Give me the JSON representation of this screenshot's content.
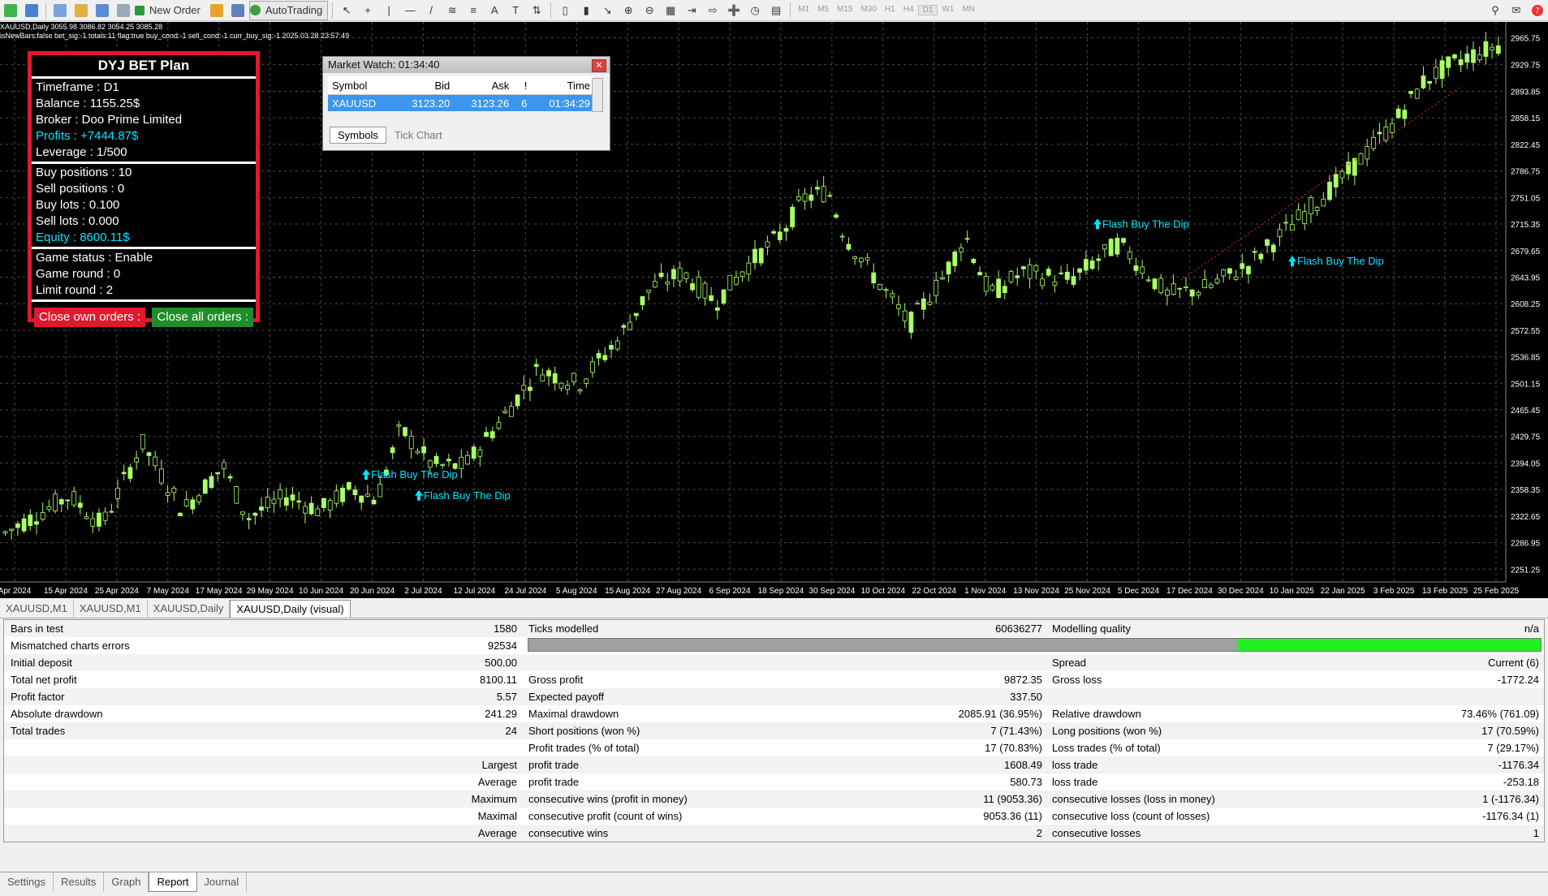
{
  "toolbar": {
    "new_order": "New Order",
    "autotrading": "AutoTrading",
    "timeframes": [
      "M1",
      "M5",
      "M15",
      "M30",
      "H1",
      "H4",
      "D1",
      "W1",
      "MN"
    ],
    "active_timeframe": "D1"
  },
  "chart": {
    "symbol_line": "XAUUSD,Daily  3055.98 3086.82 3054.25 3085.28",
    "info_line": "isNewBars:false bet_sig:-1 totals:11 flag:true buy_cond:-1 sell_cond:-1 curr_buy_sig:-1 2025.03.28 23:57:49",
    "price_labels": [
      "2965.75",
      "2929.75",
      "2893.85",
      "2858.15",
      "2822.45",
      "2786.75",
      "2751.05",
      "2715.35",
      "2679.65",
      "2643.95",
      "2608.25",
      "2572.55",
      "2536.85",
      "2501.15",
      "2465.45",
      "2429.75",
      "2394.05",
      "2358.35",
      "2322.65",
      "2286.95",
      "2251.25"
    ],
    "date_labels": [
      "Apr 2024",
      "15 Apr 2024",
      "25 Apr 2024",
      "7 May 2024",
      "17 May 2024",
      "29 May 2024",
      "10 Jun 2024",
      "20 Jun 2024",
      "2 Jul 2024",
      "12 Jul 2024",
      "24 Jul 2024",
      "5 Aug 2024",
      "15 Aug 2024",
      "27 Aug 2024",
      "6 Sep 2024",
      "18 Sep 2024",
      "30 Sep 2024",
      "10 Oct 2024",
      "22 Oct 2024",
      "1 Nov 2024",
      "13 Nov 2024",
      "25 Nov 2024",
      "5 Dec 2024",
      "17 Dec 2024",
      "30 Dec 2024",
      "10 Jan 2025",
      "22 Jan 2025",
      "3 Feb 2025",
      "13 Feb 2025",
      "25 Feb 2025"
    ],
    "signals": [
      {
        "label": "Flash Buy The Dip"
      },
      {
        "label": "Flash Buy The Dip"
      },
      {
        "label": "Flash Buy The Dip"
      },
      {
        "label": "Flash Buy The Dip"
      }
    ],
    "colors": {
      "background": "#000000",
      "bull": "#aaff66",
      "bear": "#000000",
      "signal": "#00e5ff"
    }
  },
  "panel": {
    "title": "DYJ BET Plan",
    "timeframe": "Timeframe : D1",
    "balance": "Balance : 1155.25$",
    "broker": "Broker : Doo Prime Limited",
    "profits": "Profits : +7444.87$",
    "leverage": "Leverage : 1/500",
    "buy_positions": "Buy positions : 10",
    "sell_positions": "Sell positions : 0",
    "buy_lots": "Buy lots : 0.100",
    "sell_lots": "Sell lots : 0.000",
    "equity": "Equity : 8600.11$",
    "game_status": "Game status :  Enable",
    "game_round": "Game round : 0",
    "limit_round": "Limit round : 2",
    "close_own": "Close own orders :",
    "close_all": "Close all orders :"
  },
  "market_watch": {
    "title": "Market Watch: 01:34:40",
    "columns": [
      "Symbol",
      "Bid",
      "Ask",
      "!",
      "Time"
    ],
    "rows": [
      {
        "symbol": "XAUUSD",
        "bid": "3123.20",
        "ask": "3123.26",
        "spread": "6",
        "time": "01:34:29"
      }
    ],
    "tabs": [
      "Symbols",
      "Tick Chart"
    ]
  },
  "chart_tabs": [
    "XAUUSD,M1",
    "XAUUSD,M1",
    "XAUUSD,Daily",
    "XAUUSD,Daily (visual)"
  ],
  "report": {
    "rows": [
      {
        "l1": "Bars in test",
        "v1": "1580",
        "l2": "Ticks modelled",
        "v2": "60636277",
        "l3": "Modelling quality",
        "v3": "n/a"
      },
      {
        "l1": "Mismatched charts errors",
        "v1": "92534",
        "l2": "",
        "v2": "",
        "l3": "",
        "v3": ""
      },
      {
        "l1": "Initial deposit",
        "v1": "500.00",
        "l2": "",
        "v2": "",
        "l3": "Spread",
        "v3": "Current (6)"
      },
      {
        "l1": "Total net profit",
        "v1": "8100.11",
        "l2": "Gross profit",
        "v2": "9872.35",
        "l3": "Gross loss",
        "v3": "-1772.24"
      },
      {
        "l1": "Profit factor",
        "v1": "5.57",
        "l2": "Expected payoff",
        "v2": "337.50",
        "l3": "",
        "v3": ""
      },
      {
        "l1": "Absolute drawdown",
        "v1": "241.29",
        "l2": "Maximal drawdown",
        "v2": "2085.91 (36.95%)",
        "l3": "Relative drawdown",
        "v3": "73.46% (761.09)"
      },
      {
        "l1": "Total trades",
        "v1": "24",
        "l2": "Short positions (won %)",
        "v2": "7 (71.43%)",
        "l3": "Long positions (won %)",
        "v3": "17 (70.59%)"
      },
      {
        "l1": "",
        "v1": "",
        "l2": "Profit trades (% of total)",
        "v2": "17 (70.83%)",
        "l3": "Loss trades (% of total)",
        "v3": "7 (29.17%)"
      },
      {
        "l1": "",
        "v1": "Largest",
        "l2": "profit trade",
        "v2": "1608.49",
        "l3": "loss trade",
        "v3": "-1176.34"
      },
      {
        "l1": "",
        "v1": "Average",
        "l2": "profit trade",
        "v2": "580.73",
        "l3": "loss trade",
        "v3": "-253.18"
      },
      {
        "l1": "",
        "v1": "Maximum",
        "l2": "consecutive wins (profit in money)",
        "v2": "11 (9053.36)",
        "l3": "consecutive losses (loss in money)",
        "v3": "1 (-1176.34)"
      },
      {
        "l1": "",
        "v1": "Maximal",
        "l2": "consecutive profit (count of wins)",
        "v2": "9053.36 (11)",
        "l3": "consecutive loss (count of losses)",
        "v3": "-1176.34 (1)"
      },
      {
        "l1": "",
        "v1": "Average",
        "l2": "consecutive wins",
        "v2": "2",
        "l3": "consecutive losses",
        "v3": "1"
      }
    ],
    "quality_fraction": 0.3
  },
  "bottom_tabs": [
    "Settings",
    "Results",
    "Graph",
    "Report",
    "Journal"
  ],
  "active_bottom_tab": "Report"
}
